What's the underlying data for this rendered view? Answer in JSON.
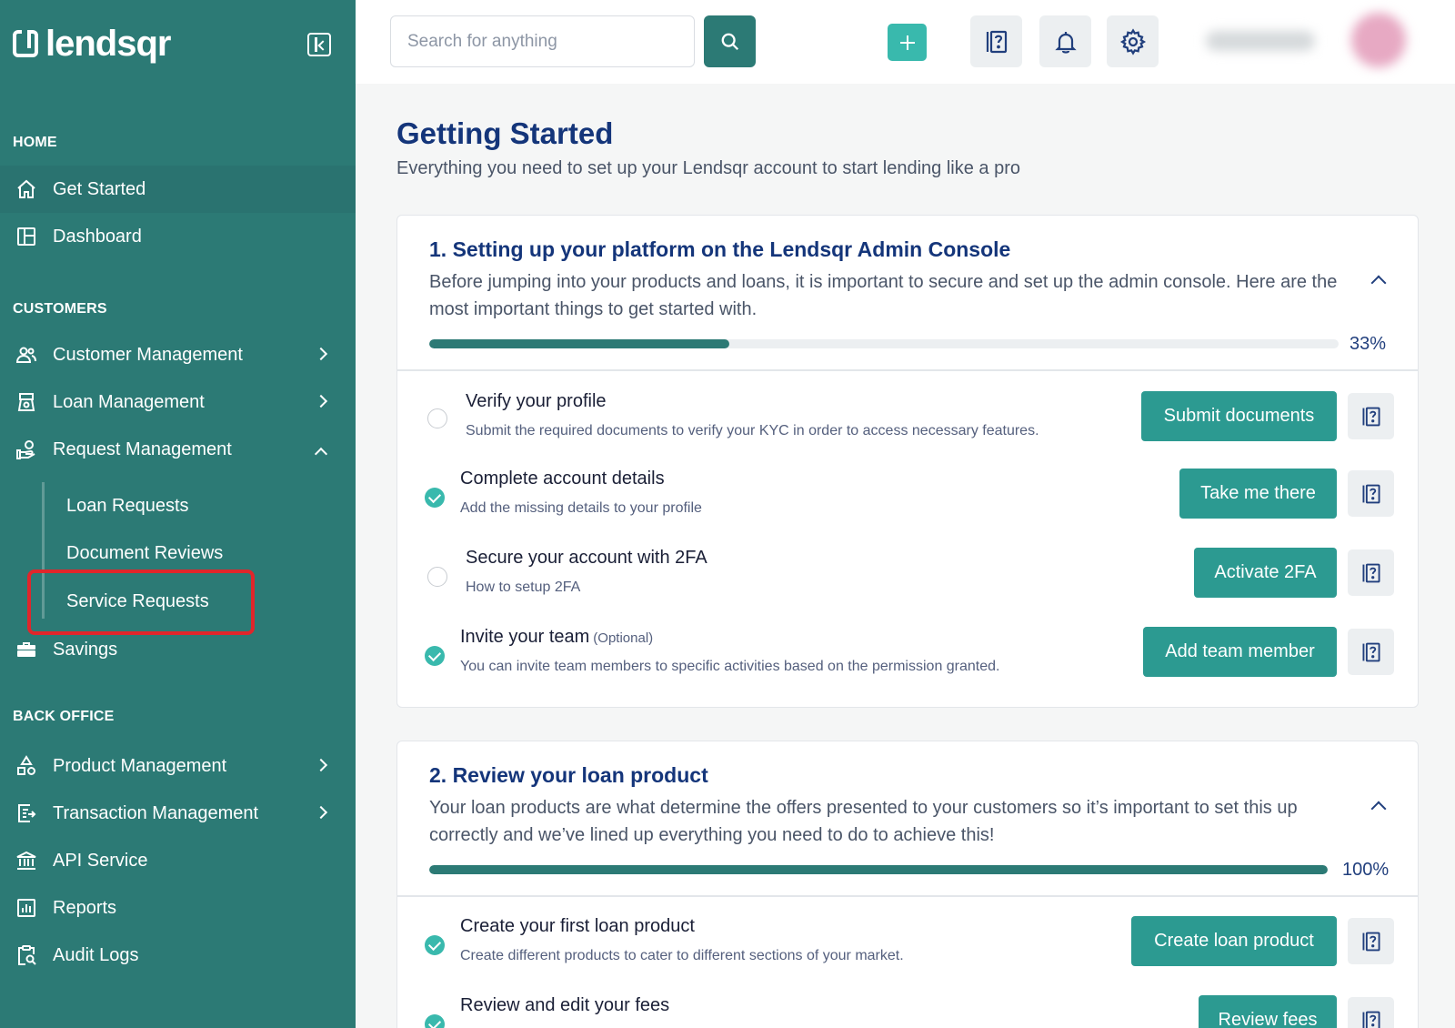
{
  "brand": {
    "name": "lendsqr"
  },
  "sidebar": {
    "sections": {
      "home": "HOME",
      "customers": "CUSTOMERS",
      "back_office": "BACK OFFICE"
    },
    "home_items": [
      {
        "label": "Get Started",
        "icon": "home-icon"
      },
      {
        "label": "Dashboard",
        "icon": "dashboard-icon"
      }
    ],
    "customer_items": [
      {
        "label": "Customer Management",
        "icon": "users-icon"
      },
      {
        "label": "Loan Management",
        "icon": "bank-building-icon"
      },
      {
        "label": "Request Management",
        "icon": "hand-request-icon"
      }
    ],
    "request_sub_items": [
      {
        "label": "Loan Requests"
      },
      {
        "label": "Document Reviews"
      },
      {
        "label": "Service Requests"
      }
    ],
    "savings": {
      "label": "Savings",
      "icon": "briefcase-icon"
    },
    "back_office_items": [
      {
        "label": "Product Management",
        "icon": "shapes-icon"
      },
      {
        "label": "Transaction Management",
        "icon": "transactions-icon"
      },
      {
        "label": "API Service",
        "icon": "institution-icon"
      },
      {
        "label": "Reports",
        "icon": "bar-chart-icon"
      },
      {
        "label": "Audit Logs",
        "icon": "clipboard-search-icon"
      }
    ]
  },
  "topbar": {
    "search_placeholder": "Search for anything"
  },
  "main": {
    "title": "Getting Started",
    "subtitle": "Everything you need to set up your Lendsqr account to start lending like a pro"
  },
  "cards": [
    {
      "title": "1. Setting up your platform on the Lendsqr Admin Console",
      "description": "Before jumping into your products and loans, it is important to secure and set up the admin console. Here are the most important things to get started with.",
      "progress_label": "33%",
      "progress": 0.33,
      "tasks": [
        {
          "title": "Verify your profile",
          "optional": "",
          "desc": "Submit the required documents to verify your KYC in order to access necessary features.",
          "button": "Submit documents",
          "done": false
        },
        {
          "title": "Complete account details",
          "optional": "",
          "desc": "Add the missing details to your profile",
          "button": "Take me there",
          "done": true
        },
        {
          "title": "Secure your account with 2FA",
          "optional": "",
          "desc": "How to setup 2FA",
          "button": "Activate 2FA",
          "done": false
        },
        {
          "title": "Invite your team",
          "optional": "(Optional)",
          "desc": "You can invite team members to specific activities based on the permission granted.",
          "button": "Add team member",
          "done": true
        }
      ]
    },
    {
      "title": "2. Review your loan product",
      "description": "Your loan products are what determine the offers presented to your customers so it’s important to set this up correctly and we’ve lined up everything you need to do to achieve this!",
      "progress_label": "100%",
      "progress": 1.0,
      "tasks": [
        {
          "title": "Create your first loan product",
          "optional": "",
          "desc": "Create different products to cater to different sections of your market.",
          "button": "Create loan product",
          "done": true
        },
        {
          "title": "Review and edit your fees",
          "optional": "",
          "desc": "",
          "button": "Review fees",
          "done": true
        }
      ]
    }
  ],
  "colors": {
    "sidebar": "#2c7a75",
    "accent": "#39b9ad",
    "button": "#2c9a91",
    "title": "#14357a",
    "highlight": "#e0262b"
  }
}
